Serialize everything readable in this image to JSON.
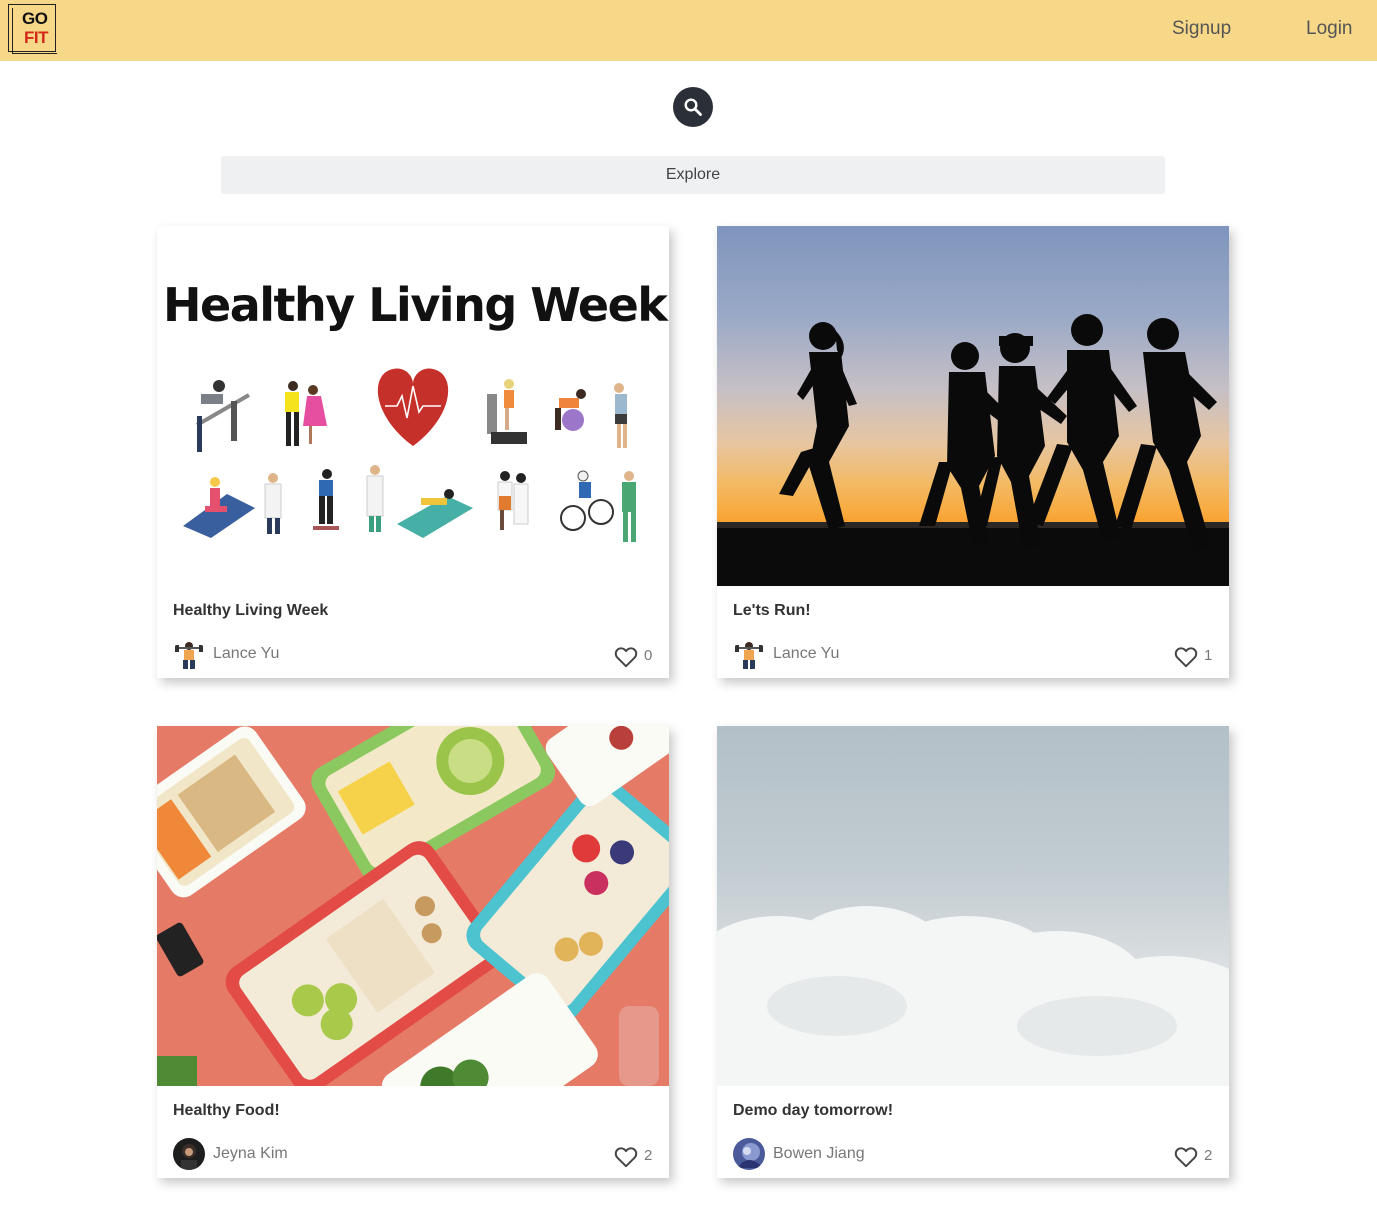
{
  "app": {
    "logo_top": "GO",
    "logo_bottom": "FIT"
  },
  "nav": {
    "signup": "Signup",
    "login": "Login"
  },
  "search": {
    "icon": "search-icon"
  },
  "explore": {
    "label": "Explore"
  },
  "posts": [
    {
      "image_text": "Healthy Living Week",
      "title": "Healthy Living Week",
      "author": "Lance Yu",
      "likes": "0"
    },
    {
      "title": "Le'ts Run!",
      "author": "Lance Yu",
      "likes": "1"
    },
    {
      "title": "Healthy Food!",
      "author": "Jeyna Kim",
      "likes": "2"
    },
    {
      "title": "Demo day tomorrow!",
      "author": "Bowen Jiang",
      "likes": "2"
    }
  ],
  "colors": {
    "header": "#f7d888",
    "search_button": "#2b2f38",
    "explore_bg": "#eff0f2",
    "logo_fit": "#d4281a"
  }
}
